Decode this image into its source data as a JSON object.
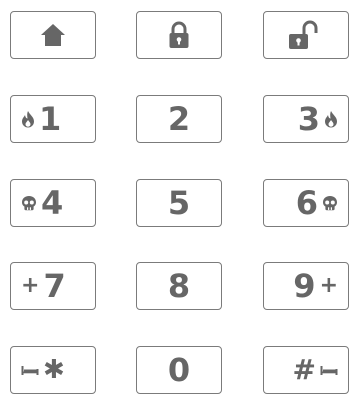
{
  "keypad": {
    "colors": {
      "border": "#7b7b7b",
      "glyph": "#666666",
      "background": "#ffffff"
    },
    "row1": [
      {
        "icon": "home-icon"
      },
      {
        "icon": "lock-icon"
      },
      {
        "icon": "unlock-icon"
      }
    ],
    "row2": [
      {
        "digit": "1",
        "icon": "fire-icon"
      },
      {
        "digit": "2"
      },
      {
        "digit": "3",
        "icon": "fire-icon"
      }
    ],
    "row3": [
      {
        "digit": "4",
        "icon": "skull-icon"
      },
      {
        "digit": "5"
      },
      {
        "digit": "6",
        "icon": "skull-icon"
      }
    ],
    "row4": [
      {
        "digit": "7",
        "symbol": "+"
      },
      {
        "digit": "8"
      },
      {
        "digit": "9",
        "symbol": "+"
      }
    ],
    "row5": [
      {
        "symbol": "✱",
        "icon": "bed-icon"
      },
      {
        "digit": "0"
      },
      {
        "symbol": "#",
        "icon": "bed-icon"
      }
    ]
  }
}
